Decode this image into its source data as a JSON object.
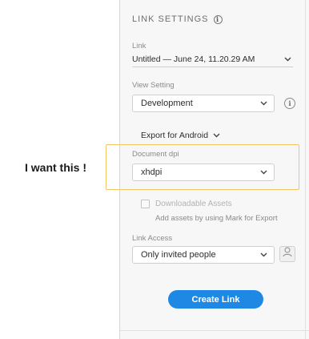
{
  "annotation": {
    "text": "I want this !"
  },
  "panel": {
    "title": "LINK SETTINGS",
    "link": {
      "label": "Link",
      "value": "Untitled — June 24, 11.20.29 AM"
    },
    "view_setting": {
      "label": "View Setting",
      "value": "Development"
    },
    "export": {
      "label": "Export for Android"
    },
    "document_dpi": {
      "label": "Document dpi",
      "value": "xhdpi"
    },
    "downloadable": {
      "label": "Downloadable Assets",
      "sublabel": "Add assets by using Mark for Export",
      "checked": false
    },
    "link_access": {
      "label": "Link Access",
      "value": "Only invited people"
    },
    "create_button": {
      "label": "Create Link"
    }
  },
  "colors": {
    "highlight": "#f2c665",
    "primary_button": "#1f88e5",
    "panel_bg": "#f7f7f7"
  },
  "icons": [
    "info-icon",
    "chevron-down-icon",
    "settings-info-icon",
    "user-icon"
  ]
}
